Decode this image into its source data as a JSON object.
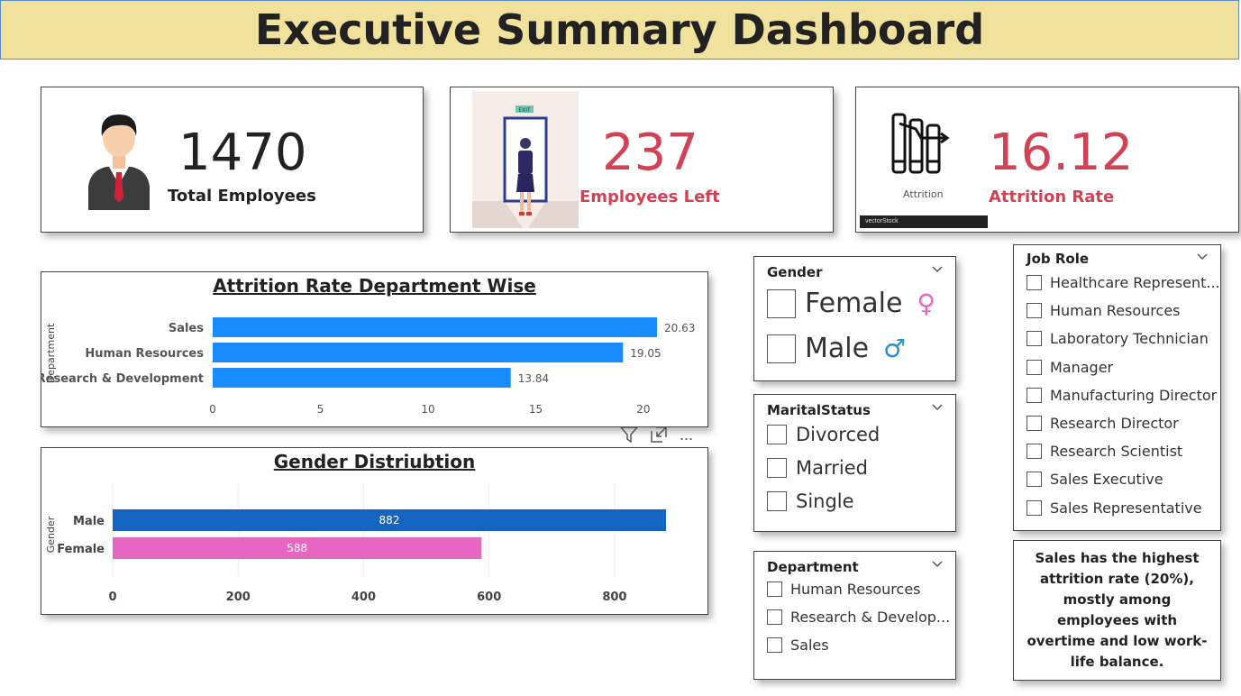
{
  "dashboard": {
    "title": "Executive Summary Dashboard"
  },
  "kpis": {
    "total": {
      "value": "1470",
      "label": "Total Employees"
    },
    "left": {
      "value": "237",
      "label": "Employees Left",
      "exit_sign": "EXIT"
    },
    "rate": {
      "value": "16.12",
      "label": "Attrition Rate",
      "image_caption": "Attrition",
      "watermark": "vectorStock"
    }
  },
  "colors": {
    "accent_red": "#d14254",
    "bar_blue": "#1a8cff",
    "male_blue": "#1565c0",
    "female_pink": "#e667c0",
    "title_bg": "#f0e19c"
  },
  "charts": [
    {
      "type": "bar",
      "title": "Attrition Rate Department Wise",
      "ylabel": "Department",
      "categories": [
        "Sales",
        "Human Resources",
        "Research & Development"
      ],
      "values": [
        20.63,
        19.05,
        13.84
      ],
      "value_labels": [
        "20.63",
        "19.05",
        "13.84"
      ],
      "xlim": [
        0,
        20.63
      ],
      "ticks": [
        "0",
        "5",
        "10",
        "15",
        "20"
      ]
    },
    {
      "type": "bar",
      "title": "Gender Distriubtion",
      "ylabel": "Gender",
      "categories": [
        "Male",
        "Female"
      ],
      "values": [
        882,
        588
      ],
      "value_labels": [
        "882",
        "588"
      ],
      "xlim": [
        0,
        882
      ],
      "ticks": [
        "0",
        "200",
        "400",
        "600",
        "800"
      ]
    }
  ],
  "chart_data": [
    {
      "type": "bar",
      "title": "Attrition Rate Department Wise",
      "ylabel": "Department",
      "categories": [
        "Sales",
        "Human Resources",
        "Research & Development"
      ],
      "values": [
        20.63,
        19.05,
        13.84
      ],
      "xlim": [
        0,
        20.63
      ],
      "grid": false
    },
    {
      "type": "bar",
      "title": "Gender Distriubtion",
      "ylabel": "Gender",
      "categories": [
        "Male",
        "Female"
      ],
      "values": [
        882,
        588
      ],
      "xlim": [
        0,
        882
      ],
      "grid": true
    }
  ],
  "visual_menu": {
    "more_label": "..."
  },
  "slicers": {
    "gender": {
      "title": "Gender",
      "options": [
        "Female",
        "Male"
      ],
      "symbols": [
        "♀",
        "♂"
      ]
    },
    "marital": {
      "title": "MaritalStatus",
      "options": [
        "Divorced",
        "Married",
        "Single"
      ]
    },
    "department": {
      "title": "Department",
      "options": [
        "Human Resources",
        "Research & Develop...",
        "Sales"
      ]
    },
    "job_role": {
      "title": "Job Role",
      "options": [
        "Healthcare Represent...",
        "Human Resources",
        "Laboratory Technician",
        "Manager",
        "Manufacturing Director",
        "Research Director",
        "Research Scientist",
        "Sales Executive",
        "Sales Representative"
      ]
    }
  },
  "insight": {
    "text": "Sales has the highest attrition rate (20%), mostly among employees with overtime and low work-life balance."
  }
}
